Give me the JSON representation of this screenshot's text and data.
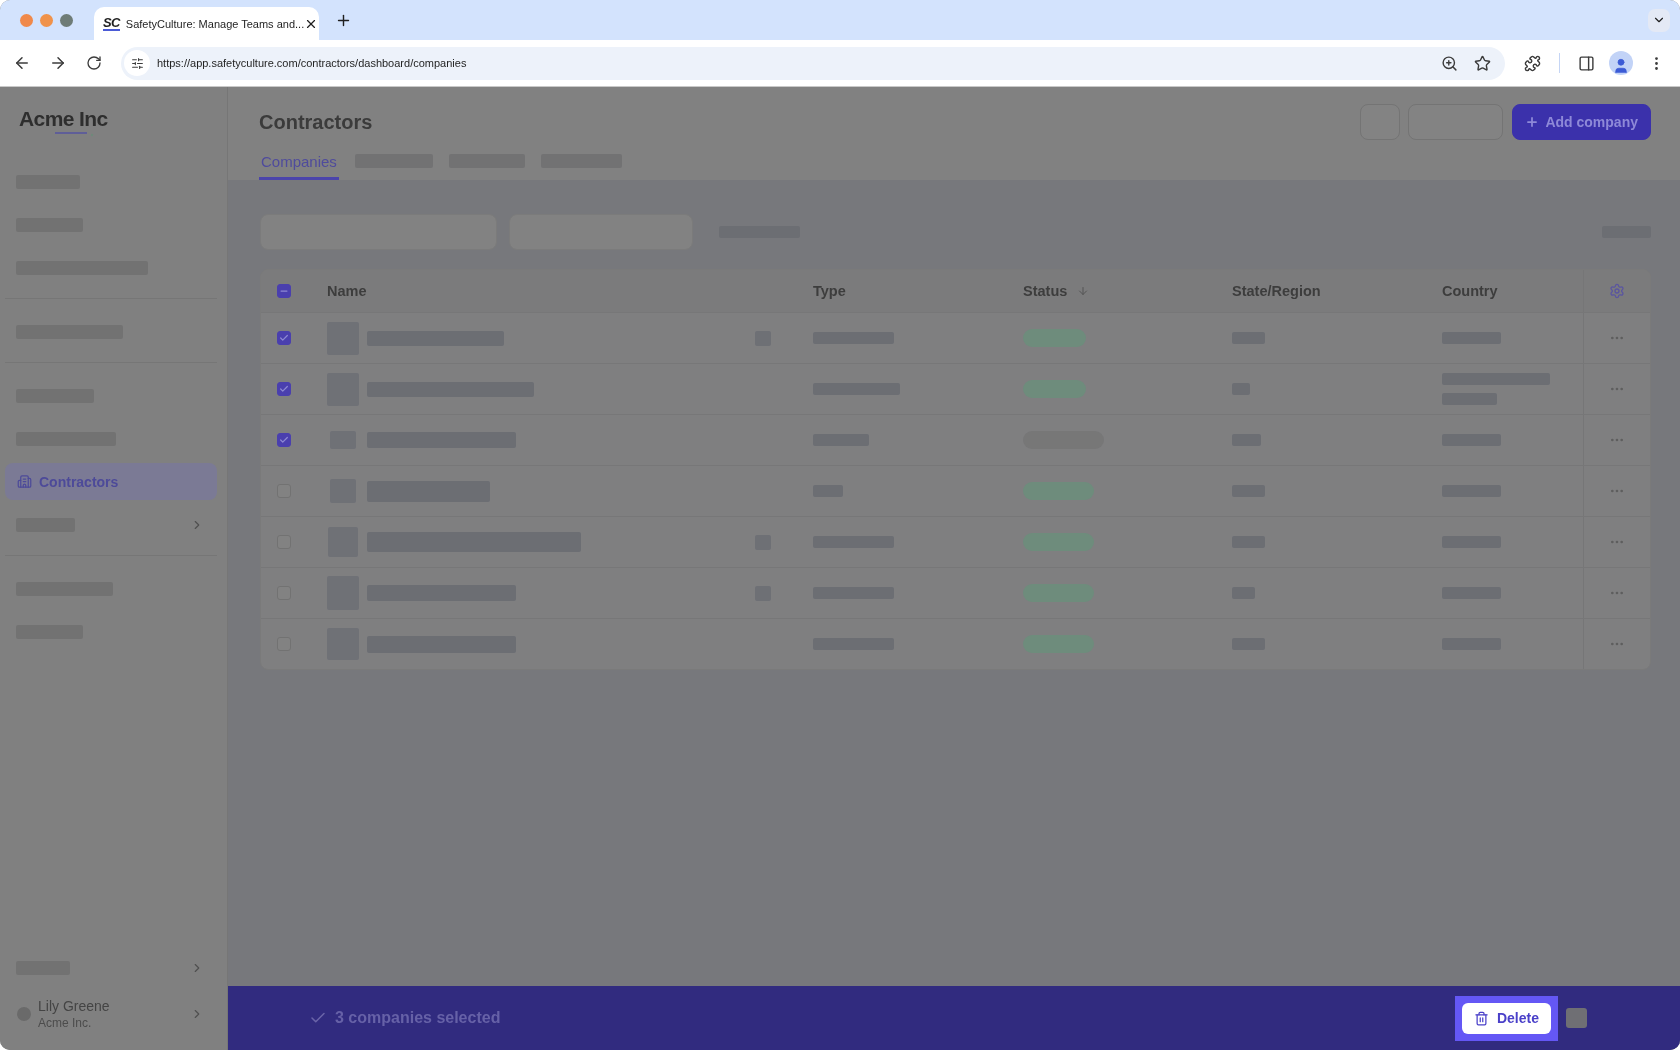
{
  "browser": {
    "tab": {
      "icon_text": "SC",
      "title": "SafetyCulture: Manage Teams and..."
    },
    "url": "https://app.safetyculture.com/contractors/dashboard/companies"
  },
  "sidebar": {
    "logo": "Acme Inc",
    "groups": [
      {
        "items": [
          {
            "kind": "redacted",
            "selected": false,
            "expandable": false
          },
          {
            "kind": "redacted",
            "selected": false,
            "expandable": false
          },
          {
            "kind": "redacted",
            "selected": false,
            "expandable": false
          }
        ]
      },
      {
        "items": [
          {
            "kind": "redacted",
            "selected": false,
            "expandable": false
          }
        ]
      },
      {
        "items": [
          {
            "kind": "redacted",
            "selected": false,
            "expandable": false
          },
          {
            "kind": "redacted",
            "selected": false,
            "expandable": false
          },
          {
            "kind": "link",
            "label": "Contractors",
            "selected": true,
            "expandable": false
          },
          {
            "kind": "redacted",
            "selected": false,
            "expandable": true
          }
        ]
      },
      {
        "items": [
          {
            "kind": "redacted",
            "selected": false,
            "expandable": false
          },
          {
            "kind": "redacted",
            "selected": false,
            "expandable": false
          }
        ]
      }
    ],
    "footer": {
      "items": [
        {
          "kind": "redacted",
          "selected": false,
          "expandable": true
        }
      ],
      "user": {
        "name": "Lily Greene",
        "organization": "Acme Inc."
      }
    }
  },
  "header": {
    "title": "Contractors",
    "buttons": [
      {
        "kind": "icon"
      },
      {
        "kind": "outline"
      },
      {
        "kind": "primary",
        "label": "Add company"
      }
    ],
    "tabs": [
      {
        "kind": "text",
        "label": "Companies",
        "selected": true
      },
      {
        "kind": "redacted",
        "selected": false
      },
      {
        "kind": "redacted",
        "selected": false
      },
      {
        "kind": "redacted",
        "selected": false
      }
    ]
  },
  "table": {
    "select_all": {
      "indeterminate": true
    },
    "columns": [
      {
        "label": "Name",
        "sorted": false
      },
      {
        "label": "Type",
        "sorted": false
      },
      {
        "label": "Status",
        "sorted": true
      },
      {
        "label": "State/Region",
        "sorted": false
      },
      {
        "label": "Country",
        "sorted": false
      }
    ],
    "rows": [
      {
        "checked": true,
        "badge_icon": true,
        "status": {
          "color": "#6e8c7c"
        }
      },
      {
        "checked": true,
        "badge_icon": false,
        "status": {
          "color": "#6e8c7c"
        }
      },
      {
        "checked": true,
        "badge_icon": false,
        "status": {
          "color": "#777777"
        }
      },
      {
        "checked": false,
        "badge_icon": false,
        "status": {
          "color": "#6e8c7c"
        }
      },
      {
        "checked": false,
        "badge_icon": true,
        "status": {
          "color": "#6e8c7c"
        }
      },
      {
        "checked": false,
        "badge_icon": true,
        "status": {
          "color": "#6e8c7c"
        }
      },
      {
        "checked": false,
        "badge_icon": false,
        "status": {
          "color": "#6e8c7c"
        }
      }
    ]
  },
  "selection_bar": {
    "text": "3 companies selected",
    "delete_button": {
      "label": "Delete",
      "highlighted": true
    }
  }
}
